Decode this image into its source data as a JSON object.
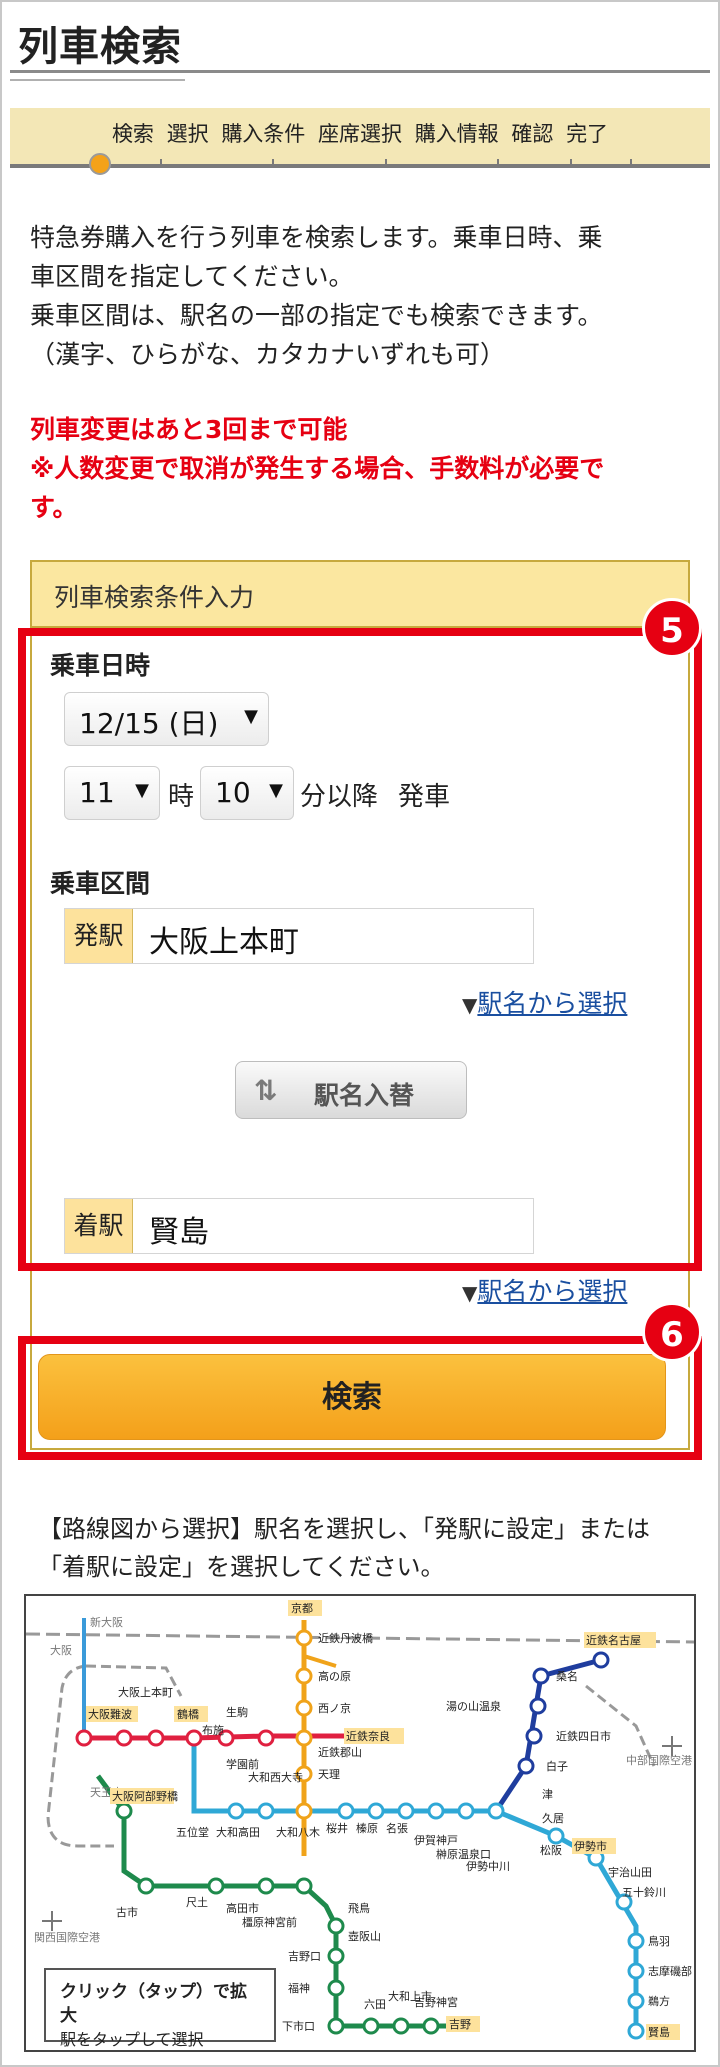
{
  "page": {
    "title": "列車検索"
  },
  "steps": [
    "検索",
    "選択",
    "購入条件",
    "座席選択",
    "購入情報",
    "確認",
    "完了"
  ],
  "intro": [
    "特急券購入を行う列車を検索します。乗車日時、乗",
    "車区間を指定してください。",
    "乗車区間は、駅名の一部の指定でも検索できます。",
    "（漢字、ひらがな、カタカナいずれも可）"
  ],
  "alert": [
    "列車変更はあと3回まで可能",
    "※人数変更で取消が発生する場合、手数料が必要で",
    "す。"
  ],
  "panel": {
    "header": "列車検索条件入力",
    "datetime_label": "乗車日時",
    "date_value": "12/15 (日)",
    "hour_value": "11",
    "hour_unit": "時",
    "minute_value": "10",
    "minute_suffix": "分以降",
    "depart_label": "発車",
    "section_label": "乗車区間",
    "from_tag": "発駅",
    "from_value": "大阪上本町",
    "select_by_name": "駅名から選択",
    "swap_label": "駅名入替",
    "to_tag": "着駅",
    "to_value": "賢島",
    "search_label": "検索"
  },
  "badges": {
    "five": "5",
    "six": "6"
  },
  "map": {
    "caption": [
      "【路線図から選択】駅名を選択し、「発駅に設定」または",
      "「着駅に設定」を選択してください。"
    ],
    "note_title": "クリック（タップ）で拡大",
    "note_sub": "駅をタップして選択",
    "stations": {
      "shin_osaka": "新大阪",
      "osaka": "大阪",
      "kyoto": "京都",
      "kintetsu_nagoya": "近鉄名古屋",
      "osaka_namba": "大阪難波",
      "osaka_uehommachi": "大阪上本町",
      "tsuruhashi": "鶴橋",
      "fuse": "布施",
      "ikoma": "生駒",
      "kintetsu_nara": "近鉄奈良",
      "gakuenmae": "学園前",
      "yamato_saidaiji": "大和西大寺",
      "kintetsu_tambabashi": "近鉄丹波橋",
      "takanohara": "高の原",
      "nishinokyo": "西ノ京",
      "kintetsu_koriyama": "近鉄郡山",
      "tenri": "天理",
      "tennoji": "天王寺",
      "osaka_abenobashi": "大阪阿部野橋",
      "kansai_airport": "関西国際空港",
      "goidou": "五位堂",
      "yamato_takada": "大和高田",
      "yamato_yagi": "大和八木",
      "sakurai": "桜井",
      "haibara": "榛原",
      "nabari": "名張",
      "iga_kambe": "伊賀神戸",
      "higashi_aoyama": "榊原温泉口",
      "iseakawa": "伊勢中川",
      "matsusaka": "松阪",
      "ise_shi": "伊勢市",
      "ujiyamada": "宇治山田",
      "isuzugawa": "五十鈴川",
      "toba": "鳥羽",
      "shima_isobe": "志摩磯部",
      "ugata": "鵜方",
      "kashikojima": "賢島",
      "yunoyama": "湯の山温泉",
      "kuwana": "桑名",
      "yokkaichi": "近鉄四日市",
      "shiroko": "白子",
      "tsu": "津",
      "hisai": "久居",
      "chubu_airport": "中部国際空港",
      "furuichi": "古市",
      "shakudo": "尺土",
      "takadaichi": "高田市",
      "kashiharajingu": "橿原神宮前",
      "asuka": "飛鳥",
      "tsubosakayama": "壺阪山",
      "yoshinoguchi": "吉野口",
      "fukugami": "福神",
      "shimoichiguchi": "下市口",
      "muda": "六田",
      "yamato_kamiichi": "大和上市",
      "yoshino_jingu": "吉野神宮",
      "yoshino": "吉野"
    }
  }
}
